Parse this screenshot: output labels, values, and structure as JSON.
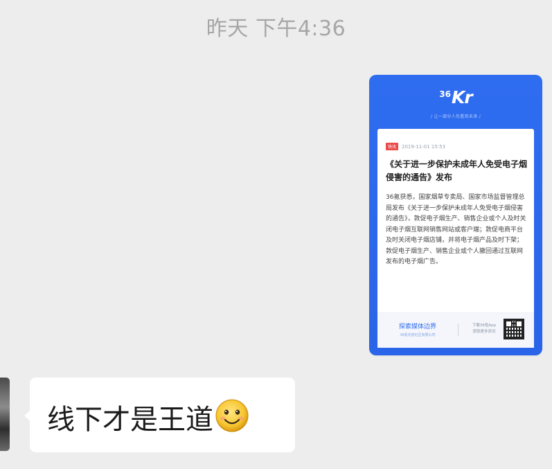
{
  "timestamp": "昨天 下午4:36",
  "article_card": {
    "logo_number": "36",
    "logo_text": "Kr",
    "slogan": "/ 让一部分人先看到未来 /",
    "tag": "快讯",
    "date": "2019-11-01 15:53",
    "headline": "《关于进一步保护未成年人免受电子烟侵害的通告》发布",
    "body": "36氪获悉，国家烟草专卖局、国家市场监督管理总局发布《关于进一步保护未成年人免受电子烟侵害的通告》，敦促电子烟生产、销售企业或个人及时关闭电子烟互联网销售网站或客户端；敦促电商平台及时关闭电子烟店铺，并将电子烟产品及时下架；敦促电子烟生产、销售企业或个人撤回通过互联网发布的电子烟广告。",
    "footer_left_title": "探索媒体边界",
    "footer_left_sub": "36氪内容社区有限公司",
    "footer_mid_line1": "下载36氪App",
    "footer_mid_line2": "获取更多资讯"
  },
  "message": {
    "text": "线下才是王道",
    "emoji": "smile-emoji"
  },
  "colors": {
    "background": "#ededed",
    "card_blue": "#2f6df0",
    "tag_red": "#e94b4b",
    "bubble": "#ffffff"
  }
}
